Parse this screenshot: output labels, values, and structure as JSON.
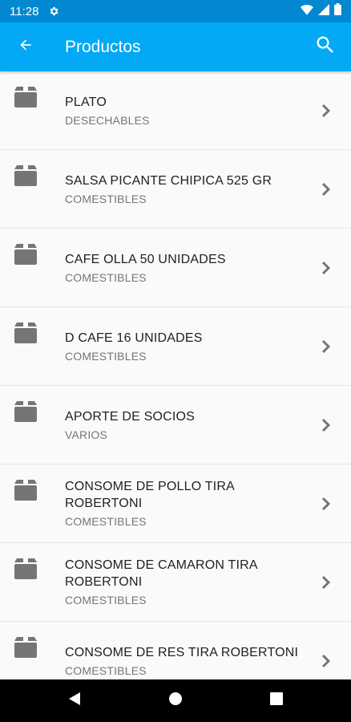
{
  "status_bar": {
    "time": "11:28",
    "icons": [
      "gear-icon",
      "wifi-icon",
      "signal-icon",
      "battery-icon"
    ]
  },
  "app_bar": {
    "title": "Productos",
    "back_icon": "arrow-back-icon",
    "search_icon": "search-icon"
  },
  "colors": {
    "app_bar": "#03A9F4",
    "status_bar": "#0288D1",
    "icon_gray": "#757575",
    "text_primary": "#212121",
    "text_secondary": "#757575"
  },
  "products": [
    {
      "name": "PLATO",
      "category": "DESECHABLES"
    },
    {
      "name": "SALSA PICANTE CHIPICA 525 GR",
      "category": "COMESTIBLES"
    },
    {
      "name": "CAFE OLLA 50 UNIDADES",
      "category": "COMESTIBLES"
    },
    {
      "name": "D CAFE 16 UNIDADES",
      "category": "COMESTIBLES"
    },
    {
      "name": "APORTE DE SOCIOS",
      "category": "VARIOS"
    },
    {
      "name": "CONSOME DE POLLO TIRA ROBERTONI",
      "category": "COMESTIBLES"
    },
    {
      "name": "CONSOME DE CAMARON TIRA ROBERTONI",
      "category": "COMESTIBLES"
    },
    {
      "name": "CONSOME DE RES TIRA ROBERTONI",
      "category": "COMESTIBLES"
    }
  ],
  "nav_bar": {
    "buttons": [
      "back-triangle-icon",
      "home-circle-icon",
      "recents-square-icon"
    ]
  }
}
